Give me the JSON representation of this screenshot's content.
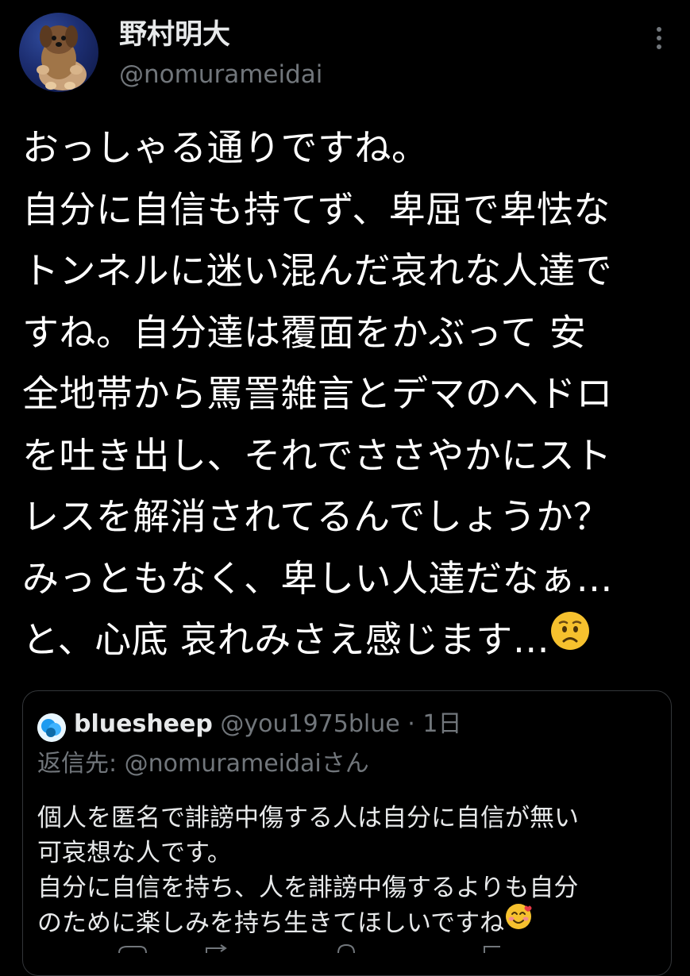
{
  "author": {
    "name": "野村明大",
    "handle": "@nomurameidai"
  },
  "tweet": {
    "lines": [
      "おっしゃる通りですね。",
      "自分に自信も持てず、卑屈で卑怯な",
      "トンネルに迷い混んだ哀れな人達で",
      "すね。自分達は覆面をかぶって 安",
      "全地帯から罵詈雑言とデマのヘドロ",
      "を吐き出し、それでささやかにスト",
      "レスを解消されてるんでしょうか？",
      "みっともなく、卑しい人達だなぁ…",
      "と、心底 哀れみさえ感じます…"
    ],
    "trailing_emoji": "worried-face-emoji"
  },
  "quoted_tweet": {
    "name": "bluesheep",
    "handle": "@you1975blue",
    "separator": "·",
    "time": "1日",
    "reply_to": "返信先: @nomurameidaiさん",
    "lines": [
      "個人を匿名で誹謗中傷する人は自分に自信が無い",
      "可哀想な人です。",
      "自分に自信を持ち、人を誹謗中傷するよりも自分",
      "のために楽しみを持ち生きてほしいですね"
    ],
    "trailing_emoji": "smiling-face-with-hearts-emoji"
  },
  "colors": {
    "background": "#000000",
    "text": "#ffffff",
    "secondary": "#71767b",
    "border": "#333639"
  }
}
